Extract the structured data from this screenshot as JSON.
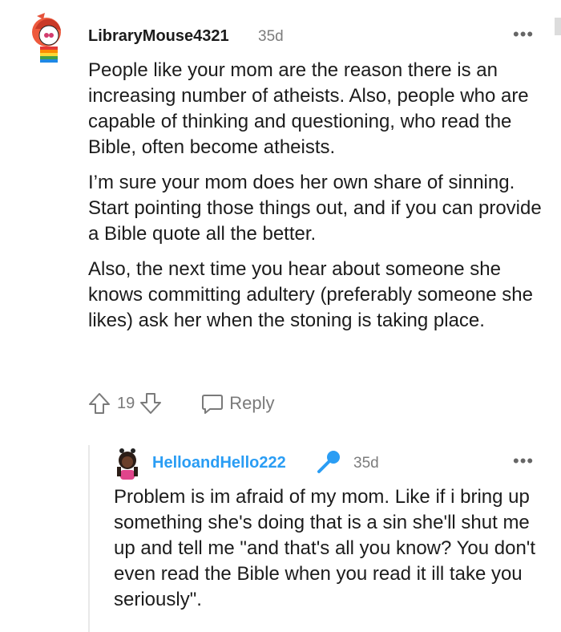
{
  "comment1": {
    "username": "LibraryMouse4321",
    "age": "35d",
    "more_icon": "more-horizontal-icon",
    "paragraphs": [
      "People like your mom are the reason there is an increasing number of atheists. Also, people who are capable of thinking and questioning, who read the Bible, often become atheists.",
      "I’m sure your mom does her own share of sinning. Start pointing those things out, and if you can provide a Bible quote all the better.",
      "Also, the next time you hear about someone she knows committing adultery (preferably someone she likes) ask her when the stoning is taking place."
    ],
    "vote_count": "19",
    "reply_label": "Reply"
  },
  "comment2": {
    "username": "HelloandHello222",
    "username_color": "#2a9df4",
    "badge_icon": "microphone-icon",
    "age": "35d",
    "more_icon": "more-horizontal-icon",
    "paragraphs": [
      "Problem is im afraid of my mom. Like if i bring up something she's doing that is a sin she'll shut me up and tell me \"and that's all you know? You don't even read the Bible when you read it ill take you seriously\"."
    ]
  }
}
